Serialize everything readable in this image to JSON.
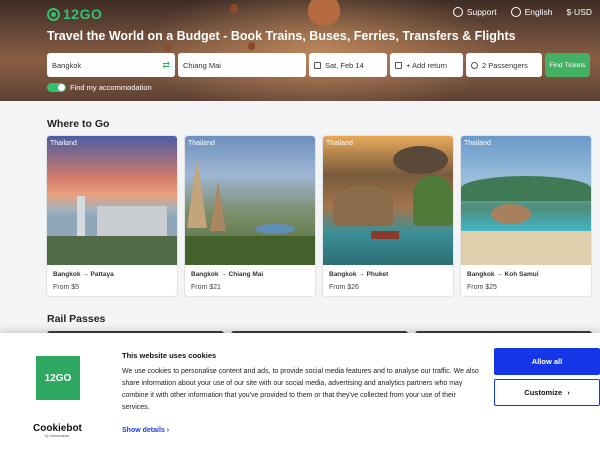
{
  "header": {
    "logo_text": "12GO",
    "links": {
      "support": "Support",
      "language": "English",
      "currency": "$·USD"
    },
    "title": "Travel the World on a Budget - Book Trains, Buses, Ferries, Transfers & Flights"
  },
  "search": {
    "from": "Bangkok",
    "to": "Chiang Mai",
    "date": "Sat, Feb 14",
    "return": "+ Add return",
    "passengers": "2 Passengers",
    "find_button": "Find Tickets",
    "accommodation_label": "Find my accommodation",
    "accommodation_on": true
  },
  "where_to_go": {
    "title": "Where to Go",
    "cards": [
      {
        "country": "Thailand",
        "route": "Bangkok → Pattaya",
        "price": "From $5"
      },
      {
        "country": "Thailand",
        "route": "Bangkok → Chiang Mai",
        "price": "From $21"
      },
      {
        "country": "Thailand",
        "route": "Bangkok → Phuket",
        "price": "From $26"
      },
      {
        "country": "Thailand",
        "route": "Bangkok → Koh Samui",
        "price": "From $25"
      }
    ]
  },
  "rail_passes": {
    "title": "Rail Passes"
  },
  "cookie_banner": {
    "logo_text": "12GO",
    "brand": "Cookiebot",
    "brand_sub": "by Usercentrics",
    "title": "This website uses cookies",
    "body": "We use cookies to personalise content and ads, to provide social media features and to analyse our traffic. We also share information about your use of our site with our social media, advertising and analytics partners who may combine it with other information that you've provided to them or that they've collected from your use of their services.",
    "show_details": "Show details",
    "allow_all": "Allow all",
    "customize": "Customize"
  },
  "colors": {
    "brand_green": "#34c06c",
    "find_button": "#43b062",
    "cookie_primary": "#1436e6"
  }
}
